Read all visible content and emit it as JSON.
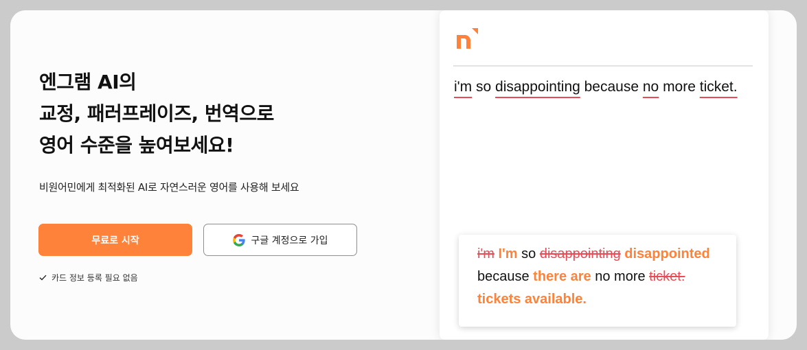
{
  "hero": {
    "headline": [
      "엔그램 AI의",
      "교정, 패러프레이즈, 번역으로",
      "영어 수준을 높여보세요!"
    ],
    "subtitle": "비원어민에게 최적화된 AI로 자연스러운 영어를 사용해 보세요",
    "primary_button": "무료로 시작",
    "google_button": "구글 계정으로 가입",
    "note": "카드 정보 등록 필요 없음"
  },
  "editor": {
    "logo_icon": "engram-logo-icon",
    "sentence": [
      {
        "text": "i'm",
        "error": true
      },
      {
        "text": " so ",
        "error": false
      },
      {
        "text": "disappointing",
        "error": true
      },
      {
        "text": " because ",
        "error": false
      },
      {
        "text": "no",
        "error": true
      },
      {
        "text": " more ",
        "error": false
      },
      {
        "text": "ticket.",
        "error": true
      }
    ],
    "suggestion": [
      {
        "text": "i'm",
        "type": "deleted"
      },
      {
        "text": " ",
        "type": "plain"
      },
      {
        "text": "I'm",
        "type": "added"
      },
      {
        "text": " so ",
        "type": "plain"
      },
      {
        "text": "disappointing",
        "type": "deleted"
      },
      {
        "text": " ",
        "type": "plain"
      },
      {
        "text": "disappointed",
        "type": "added"
      },
      {
        "text": " because ",
        "type": "plain"
      },
      {
        "text": "there are",
        "type": "added"
      },
      {
        "text": " no more ",
        "type": "plain"
      },
      {
        "text": "ticket.",
        "type": "deleted"
      },
      {
        "text": " ",
        "type": "plain"
      },
      {
        "text": "tickets available.",
        "type": "added"
      }
    ]
  },
  "colors": {
    "accent": "#ff823a",
    "error": "#e94b56"
  }
}
